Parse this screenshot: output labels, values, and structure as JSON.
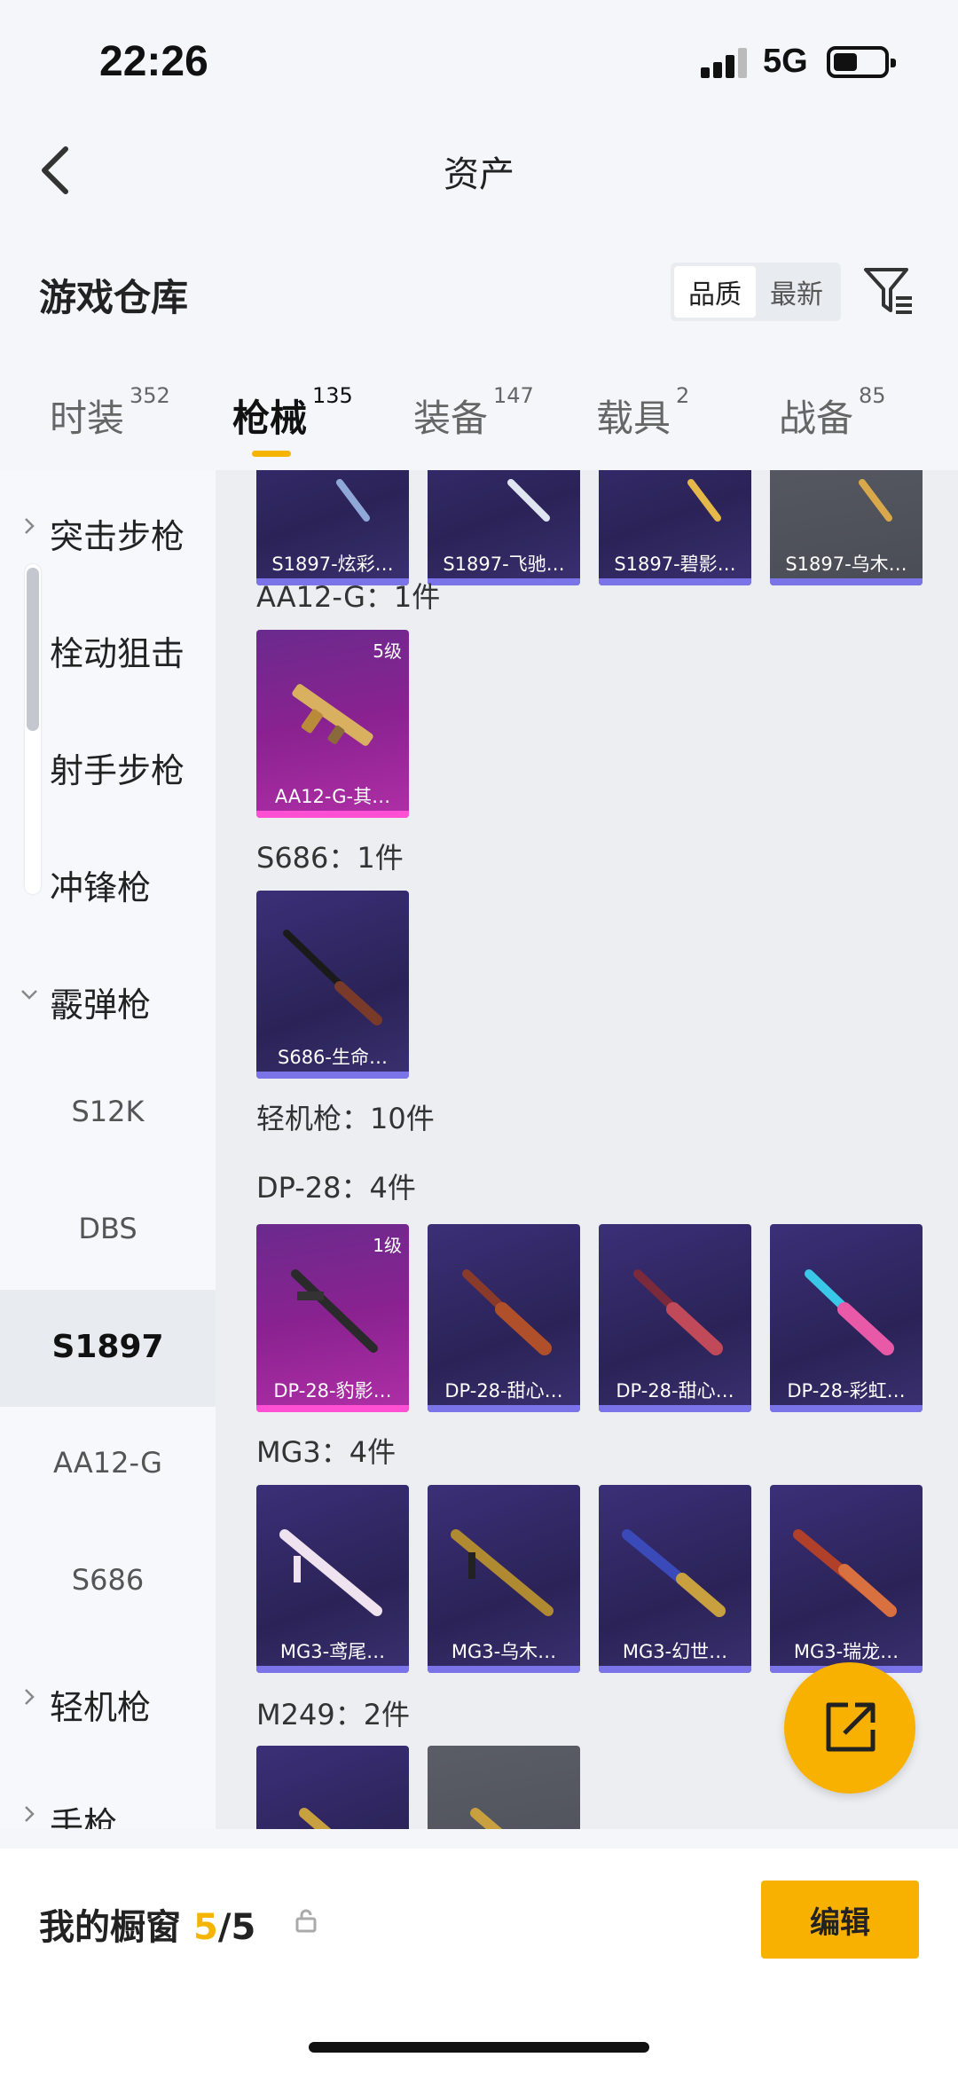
{
  "status_bar": {
    "time": "22:26",
    "network": "5G"
  },
  "header": {
    "title": "资产"
  },
  "section": {
    "title": "游戏仓库",
    "sort_options": [
      "品质",
      "最新"
    ],
    "sort_selected": "品质"
  },
  "tabs": [
    {
      "label": "时装",
      "count": "352"
    },
    {
      "label": "枪械",
      "count": "135",
      "active": true
    },
    {
      "label": "装备",
      "count": "147"
    },
    {
      "label": "载具",
      "count": "2"
    },
    {
      "label": "战备",
      "count": "85"
    }
  ],
  "sidebar": {
    "items": [
      {
        "label": "突击步枪"
      },
      {
        "label": "栓动狙击"
      },
      {
        "label": "射手步枪"
      },
      {
        "label": "冲锋枪"
      },
      {
        "label": "霰弹枪"
      },
      {
        "label": "S12K"
      },
      {
        "label": "DBS"
      },
      {
        "label": "S1897"
      },
      {
        "label": "AA12-G"
      },
      {
        "label": "S686"
      },
      {
        "label": "轻机枪"
      },
      {
        "label": "手枪"
      }
    ]
  },
  "content": {
    "top_row": [
      "S1897-炫彩…",
      "S1897-飞驰…",
      "S1897-碧影…",
      "S1897-乌木…"
    ],
    "groups": {
      "aa12": {
        "title": "AA12-G：1件",
        "items": [
          {
            "name": "AA12-G-其…",
            "level": "5级"
          }
        ]
      },
      "s686": {
        "title": "S686：1件",
        "items": [
          {
            "name": "S686-生命…"
          }
        ]
      },
      "lmg": {
        "title": "轻机枪：10件"
      },
      "dp28": {
        "title": "DP-28：4件",
        "items": [
          {
            "name": "DP-28-豹影…",
            "level": "1级"
          },
          {
            "name": "DP-28-甜心…"
          },
          {
            "name": "DP-28-甜心…"
          },
          {
            "name": "DP-28-彩虹…"
          }
        ]
      },
      "mg3": {
        "title": "MG3：4件",
        "items": [
          {
            "name": "MG3-鸢尾…"
          },
          {
            "name": "MG3-乌木…"
          },
          {
            "name": "MG3-幻世…"
          },
          {
            "name": "MG3-瑞龙…"
          }
        ]
      },
      "m249": {
        "title": "M249：2件"
      }
    }
  },
  "bottom": {
    "showcase_label": "我的橱窗",
    "showcase_count": "5",
    "showcase_total": "/5",
    "edit_label": "编辑"
  },
  "colors": {
    "accent": "#f9b100",
    "card_purple": "#2b2357",
    "card_pink": "#8a2290"
  }
}
